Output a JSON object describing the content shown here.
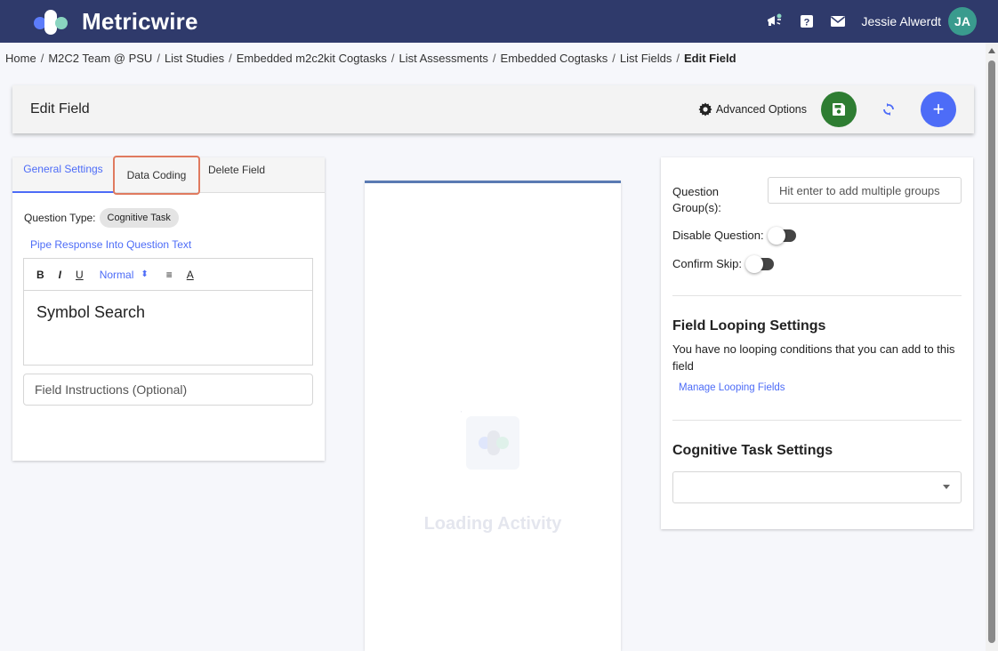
{
  "app": {
    "brand_name": "Metricwire",
    "user_name": "Jessie Alwerdt",
    "user_initials": "JA"
  },
  "breadcrumb": {
    "items": [
      "Home",
      "M2C2 Team @ PSU",
      "List Studies",
      "Embedded m2c2kit Cogtasks",
      "List Assessments",
      "Embedded Cogtasks",
      "List Fields"
    ],
    "current": "Edit Field",
    "separator": "/"
  },
  "header": {
    "title": "Edit Field",
    "advanced_options_label": "Advanced Options",
    "save_icon": "save-icon",
    "sync_icon": "sync-icon",
    "add_label": "+"
  },
  "left_panel": {
    "tabs": [
      {
        "label": "General Settings",
        "active": true
      },
      {
        "label": "Data Coding",
        "active": false,
        "highlighted": true
      },
      {
        "label": "Delete Field",
        "active": false
      }
    ],
    "question_type_label": "Question Type:",
    "question_type_value": "Cognitive Task",
    "pipe_link": "Pipe Response Into Question Text",
    "toolbar": {
      "bold": "B",
      "italic": "I",
      "underline": "U",
      "size": "Normal",
      "size_arrow": "⬍",
      "align": "≡",
      "color": "A"
    },
    "question_text": "Symbol Search",
    "instructions_placeholder": "Field Instructions (Optional)"
  },
  "preview": {
    "loading_text": "Loading Activity"
  },
  "right_panel": {
    "question_groups_label": "Question Group(s):",
    "question_groups_placeholder": "Hit enter to add multiple groups",
    "disable_question_label": "Disable Question:",
    "disable_question_on": false,
    "confirm_skip_label": "Confirm Skip:",
    "confirm_skip_on": false,
    "looping_title": "Field Looping Settings",
    "looping_text": "You have no looping conditions that you can add to this field",
    "looping_link": "Manage Looping Fields",
    "cognitive_title": "Cognitive Task Settings",
    "cognitive_select_value": ""
  },
  "colors": {
    "nav_bg": "#2f3a6b",
    "accent": "#4d6cf7",
    "save_green": "#2e7d32",
    "highlight_orange": "#e07a5f",
    "avatar_teal": "#3a9b8e"
  }
}
